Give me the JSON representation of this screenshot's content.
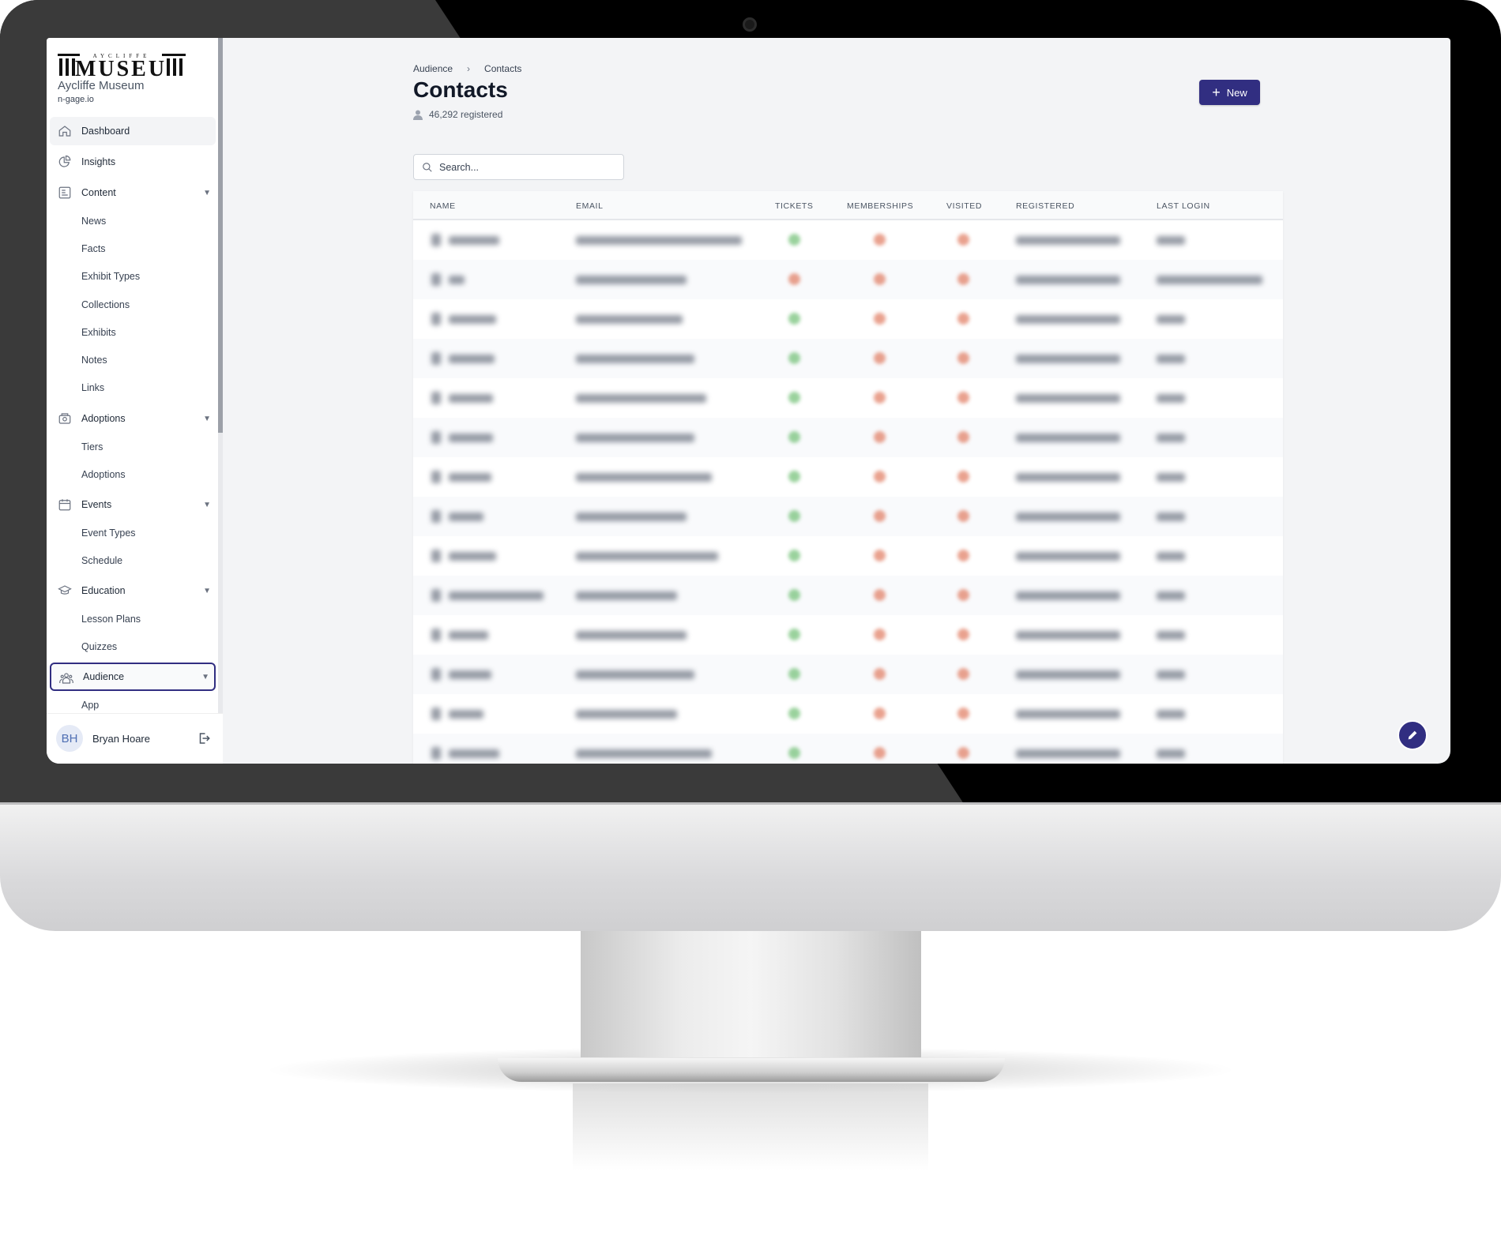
{
  "sidebar": {
    "logo_text": "AYCLIFFE MUSEUM",
    "org_name": "Aycliffe Museum",
    "domain": "n-gage.io",
    "items": [
      {
        "label": "Dashboard",
        "icon": "home-icon"
      },
      {
        "label": "Insights",
        "icon": "pie-chart-icon"
      },
      {
        "label": "Content",
        "icon": "document-icon",
        "expandable": true
      },
      {
        "label": "News"
      },
      {
        "label": "Facts"
      },
      {
        "label": "Exhibit Types"
      },
      {
        "label": "Collections"
      },
      {
        "label": "Exhibits"
      },
      {
        "label": "Notes"
      },
      {
        "label": "Links"
      },
      {
        "label": "Adoptions",
        "icon": "camera-icon",
        "expandable": true
      },
      {
        "label": "Tiers"
      },
      {
        "label": "Adoptions"
      },
      {
        "label": "Events",
        "icon": "calendar-icon",
        "expandable": true
      },
      {
        "label": "Event Types"
      },
      {
        "label": "Schedule"
      },
      {
        "label": "Education",
        "icon": "graduation-cap-icon",
        "expandable": true
      },
      {
        "label": "Lesson Plans"
      },
      {
        "label": "Quizzes"
      },
      {
        "label": "Audience",
        "icon": "users-icon",
        "expandable": true,
        "selected": true
      },
      {
        "label": "App"
      }
    ],
    "user": {
      "initials": "BH",
      "name": "Bryan Hoare"
    }
  },
  "header": {
    "breadcrumb": [
      "Audience",
      "Contacts"
    ],
    "title": "Contacts",
    "count": "46,292 registered",
    "new_label": "New"
  },
  "search": {
    "placeholder": "Search..."
  },
  "table": {
    "columns": [
      "NAME",
      "EMAIL",
      "TICKETS",
      "MEMBERSHIPS",
      "VISITED",
      "REGISTERED",
      "LAST LOGIN"
    ],
    "rows": [
      {
        "tickets": true,
        "memberships": false,
        "visited": false
      },
      {
        "tickets": false,
        "memberships": false,
        "visited": false
      },
      {
        "tickets": true,
        "memberships": false,
        "visited": false
      },
      {
        "tickets": true,
        "memberships": false,
        "visited": false
      },
      {
        "tickets": true,
        "memberships": false,
        "visited": false
      },
      {
        "tickets": true,
        "memberships": false,
        "visited": false
      },
      {
        "tickets": true,
        "memberships": false,
        "visited": false
      },
      {
        "tickets": true,
        "memberships": false,
        "visited": false
      },
      {
        "tickets": true,
        "memberships": false,
        "visited": false
      },
      {
        "tickets": true,
        "memberships": false,
        "visited": false
      },
      {
        "tickets": true,
        "memberships": false,
        "visited": false
      },
      {
        "tickets": true,
        "memberships": false,
        "visited": false
      },
      {
        "tickets": true,
        "memberships": false,
        "visited": false
      },
      {
        "tickets": true,
        "memberships": false,
        "visited": false
      }
    ]
  },
  "colors": {
    "accent": "#312e81",
    "status_yes": "#6fbf73",
    "status_no": "#e07a5f"
  }
}
